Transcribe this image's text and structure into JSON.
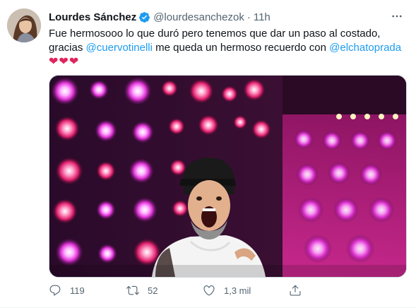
{
  "tweet": {
    "author_name": "Lourdes Sánchez",
    "handle": "@lourdesanchezok",
    "separator": "·",
    "time": "11h",
    "text_line1": "Fue hermosooo lo que duró pero tenemos que dar un paso al costado,",
    "text_gracias": "gracias",
    "mention1": "@cuervotinelli",
    "text_middle": "me queda un hermoso recuerdo con",
    "mention2": "@elchatoprada",
    "hearts": "❤❤❤",
    "reply_count": "119",
    "retweet_count": "52",
    "like_count": "1,3 mil"
  },
  "colors": {
    "accent": "#1d9bf0",
    "secondary_text": "#536471",
    "heart": "#e0245e"
  },
  "icons": [
    "verified-badge-icon",
    "more-icon",
    "reply-icon",
    "retweet-icon",
    "like-icon",
    "share-icon"
  ]
}
